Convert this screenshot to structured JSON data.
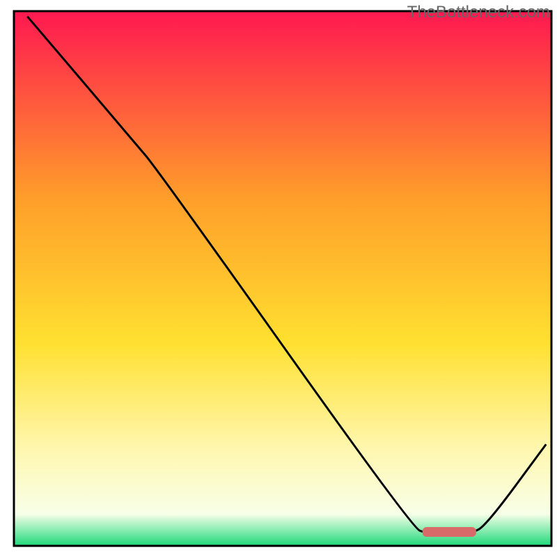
{
  "watermark": "TheBottleneck.com",
  "chart_data": {
    "type": "line",
    "title": "",
    "xlabel": "",
    "ylabel": "",
    "xlim": [
      0,
      100
    ],
    "ylim": [
      0,
      100
    ],
    "background_gradient": {
      "top": "#ff1850",
      "upper_mid": "#ff9e2a",
      "mid": "#ffe030",
      "lower_mid": "#fff7b0",
      "above_green": "#f8ffe8",
      "green": "#1ed97a"
    },
    "curve": {
      "description": "Bottleneck curve dipping to minimum near x≈82 then rising",
      "points": [
        {
          "x": 2.5,
          "y": 99
        },
        {
          "x": 22,
          "y": 76
        },
        {
          "x": 27,
          "y": 70
        },
        {
          "x": 74,
          "y": 3.5
        },
        {
          "x": 77,
          "y": 2.2
        },
        {
          "x": 85,
          "y": 2.2
        },
        {
          "x": 88,
          "y": 4
        },
        {
          "x": 99,
          "y": 19
        }
      ]
    },
    "optimal_marker": {
      "x_start": 76,
      "x_end": 86,
      "y": 2.6,
      "color": "#d96a6a"
    },
    "frame": {
      "x": 2.5,
      "y": 2.0,
      "width": 96.5,
      "height": 96.0,
      "stroke": "#000000",
      "stroke_width": 2
    }
  }
}
